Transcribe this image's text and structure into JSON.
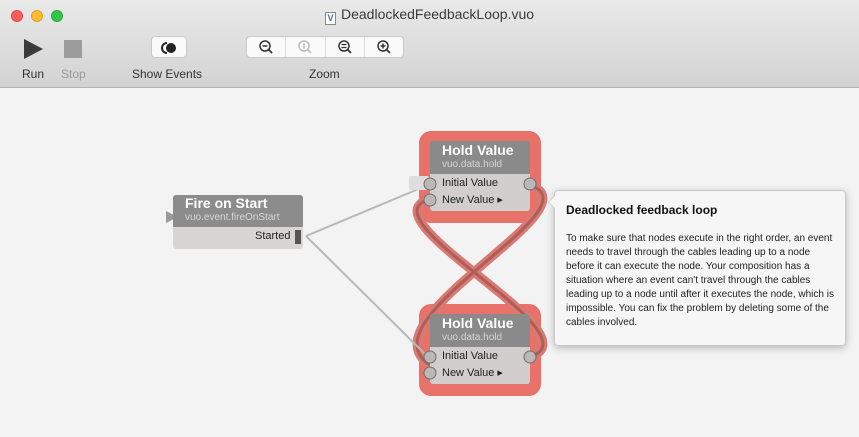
{
  "window": {
    "title": "DeadlockedFeedbackLoop.vuo",
    "doc_icon": "vuo-document-icon"
  },
  "toolbar": {
    "run_label": "Run",
    "stop_label": "Stop",
    "show_events_label": "Show Events",
    "zoom_label": "Zoom",
    "zoom_buttons": [
      "zoom-out-icon",
      "zoom-actual-icon",
      "zoom-to-fit-icon",
      "zoom-in-icon"
    ]
  },
  "nodes": {
    "fire_on_start": {
      "title": "Fire on Start",
      "class": "vuo.event.fireOnStart",
      "output_port": "Started"
    },
    "hold_value_top": {
      "title": "Hold Value",
      "class": "vuo.data.hold",
      "port_initial": "Initial Value",
      "port_new": "New Value ▸"
    },
    "hold_value_bottom": {
      "title": "Hold Value",
      "class": "vuo.data.hold",
      "port_initial": "Initial Value",
      "port_new": "New Value ▸"
    }
  },
  "tooltip": {
    "title": "Deadlocked feedback loop",
    "body": "To make sure that nodes execute in the right order, an event needs to travel through the cables leading up to a node before it can execute the node. Your composition has a situation where an event can't travel through the cables leading up to a node until after it executes the node, which is impossible. You can fix the problem by deleting some of the cables involved."
  },
  "colors": {
    "error_highlight": "#e8726a",
    "node_header": "#8a8a8a",
    "node_body": "#d2cece"
  }
}
